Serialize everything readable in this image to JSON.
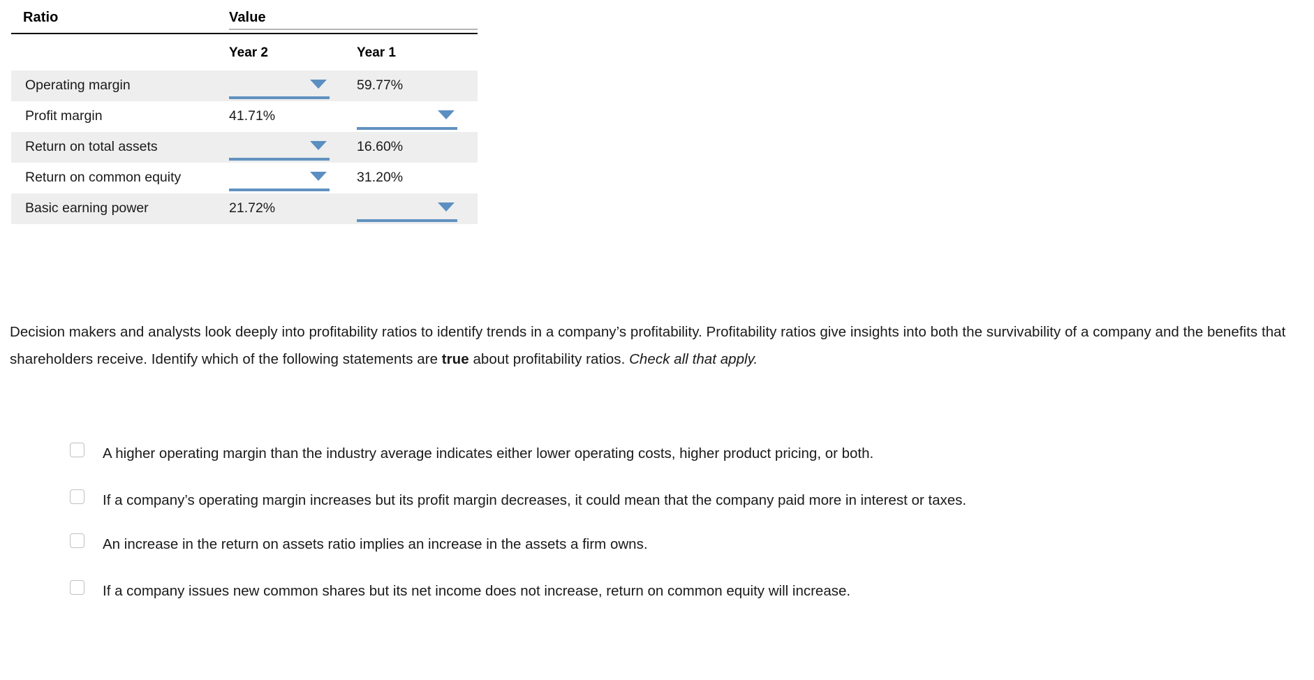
{
  "table": {
    "headers": {
      "ratio": "Ratio",
      "value": "Value",
      "year2": "Year 2",
      "year1": "Year 1"
    },
    "rows": [
      {
        "name": "Operating margin",
        "year2": {
          "kind": "dropdown",
          "value": ""
        },
        "year1": {
          "kind": "text",
          "value": "59.77%"
        }
      },
      {
        "name": "Profit margin",
        "year2": {
          "kind": "text",
          "value": "41.71%"
        },
        "year1": {
          "kind": "dropdown",
          "value": ""
        }
      },
      {
        "name": "Return on total assets",
        "year2": {
          "kind": "dropdown",
          "value": ""
        },
        "year1": {
          "kind": "text",
          "value": "16.60%"
        }
      },
      {
        "name": "Return on common equity",
        "year2": {
          "kind": "dropdown",
          "value": ""
        },
        "year1": {
          "kind": "text",
          "value": "31.20%"
        }
      },
      {
        "name": "Basic earning power",
        "year2": {
          "kind": "text",
          "value": "21.72%"
        },
        "year1": {
          "kind": "dropdown",
          "value": ""
        }
      }
    ]
  },
  "prompt": {
    "part1": "Decision makers and analysts look deeply into profitability ratios to identify trends in a company’s profitability. Profitability ratios give insights into both the survivability of a company and the benefits that shareholders receive. Identify which of the following statements are ",
    "emphasis": "true",
    "part2": " about profitability ratios. ",
    "instruction": "Check all that apply."
  },
  "options": [
    {
      "label": "A higher operating margin than the industry average indicates either lower operating costs, higher product pricing, or both.",
      "checked": false
    },
    {
      "label": "If a company’s operating margin increases but its profit margin decreases, it could mean that the company paid more in interest or taxes.",
      "checked": false
    },
    {
      "label": "An increase in the return on assets ratio implies an increase in the assets a firm owns.",
      "checked": false
    },
    {
      "label": "If a company issues new common shares but its net income does not increase, return on common equity will increase.",
      "checked": false
    }
  ],
  "colors": {
    "dropdown_blue": "#6192c0",
    "arrow_blue": "#5b8fc1",
    "row_alt_bg": "#eeeeee",
    "value_rule": "#b4b4b4",
    "header_rule": "#000000",
    "checkbox_border": "#c0c0c0"
  }
}
